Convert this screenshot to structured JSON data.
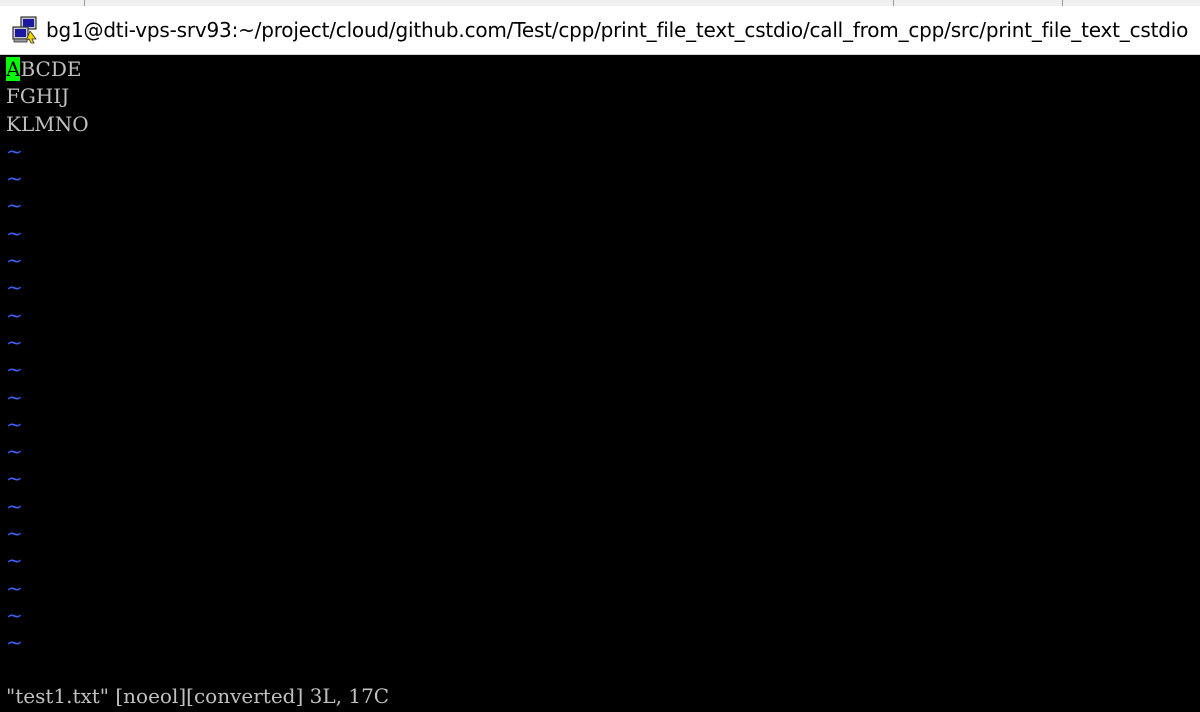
{
  "window": {
    "title": "bg1@dti-vps-srv93:~/project/cloud/github.com/Test/cpp/print_file_text_cstdio/call_from_cpp/src/print_file_text_cstdio",
    "icon": "putty-icon"
  },
  "editor": {
    "cursor_char": "A",
    "lines": [
      "BCDE",
      "FGHIJ",
      "KLMNO"
    ],
    "empty_line_marker": "~",
    "status": "\"test1.txt\" [noeol][converted] 3L, 17C"
  },
  "colors": {
    "background": "#000000",
    "text": "#c0c0c0",
    "cursor": "#00ff00",
    "tilde": "#4060ff"
  }
}
